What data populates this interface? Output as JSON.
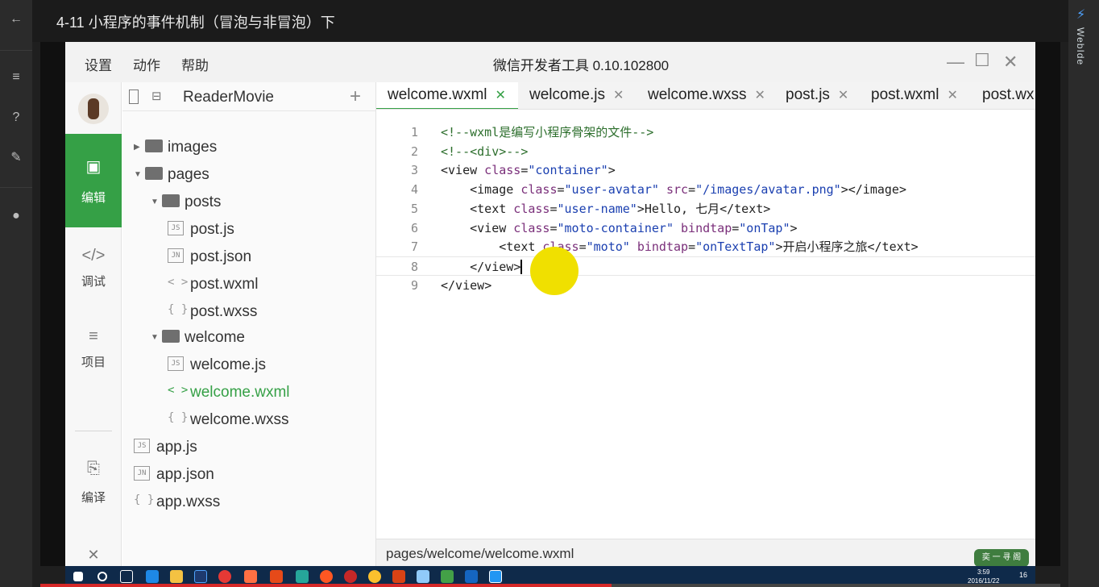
{
  "player": {
    "title": "4-11 小程序的事件机制（冒泡与非冒泡）下",
    "side_label": "WebIde",
    "progress_fraction": 0.56
  },
  "ide": {
    "menu": [
      "设置",
      "动作",
      "帮助"
    ],
    "window_title": "微信开发者工具 0.10.102800",
    "rail": {
      "edit_label": "编辑",
      "debug_label": "调试",
      "project_label": "项目",
      "compile_label": "编译"
    },
    "project_name": "ReaderMovie",
    "tree": [
      {
        "label": "images",
        "kind": "folder",
        "expanded": false
      },
      {
        "label": "pages",
        "kind": "folder",
        "expanded": true
      },
      {
        "label": "posts",
        "kind": "folder",
        "expanded": true
      },
      {
        "label": "post.js",
        "kind": "file",
        "badge": "JS"
      },
      {
        "label": "post.json",
        "kind": "file",
        "badge": "JN"
      },
      {
        "label": "post.wxml",
        "kind": "file",
        "badge": "< >"
      },
      {
        "label": "post.wxss",
        "kind": "file",
        "badge": "{ }"
      },
      {
        "label": "welcome",
        "kind": "folder",
        "expanded": true
      },
      {
        "label": "welcome.js",
        "kind": "file",
        "badge": "JS"
      },
      {
        "label": "welcome.wxml",
        "kind": "file",
        "badge": "< >",
        "selected": true
      },
      {
        "label": "welcome.wxss",
        "kind": "file",
        "badge": "{ }"
      },
      {
        "label": "app.js",
        "kind": "file",
        "badge": "JS"
      },
      {
        "label": "app.json",
        "kind": "file",
        "badge": "JN"
      },
      {
        "label": "app.wxss",
        "kind": "file",
        "badge": "{ }"
      }
    ],
    "tabs": [
      {
        "label": "welcome.wxml",
        "active": true
      },
      {
        "label": "welcome.js",
        "active": false
      },
      {
        "label": "welcome.wxss",
        "active": false
      },
      {
        "label": "post.js",
        "active": false
      },
      {
        "label": "post.wxml",
        "active": false
      },
      {
        "label": "post.wx",
        "active": false
      }
    ],
    "code_lines": [
      "<!--wxml是编写小程序骨架的文件-->",
      "<!--<div>-->",
      "<view class=\"container\">",
      "    <image class=\"user-avatar\" src=\"/images/avatar.png\"></image>",
      "    <text class=\"user-name\">Hello, 七月</text>",
      "    <view class=\"moto-container\" bindtap=\"onTap\">",
      "        <text class=\"moto\" bindtap=\"onTextTap\">开启小程序之旅</text>",
      "    </view>",
      "</view>"
    ],
    "line_numbers": [
      "1",
      "2",
      "3",
      "4",
      "5",
      "6",
      "7",
      "8",
      "9"
    ],
    "status_path": "pages/welcome/welcome.wxml",
    "watermark": "奕 一 寻 阁",
    "clock_time": "3:59",
    "clock_date": "2016/11/22",
    "clock_day": "16"
  },
  "colors": {
    "accent_green": "#35a046",
    "taskbar": "#0f2a4a",
    "progress_red": "#d62828"
  }
}
